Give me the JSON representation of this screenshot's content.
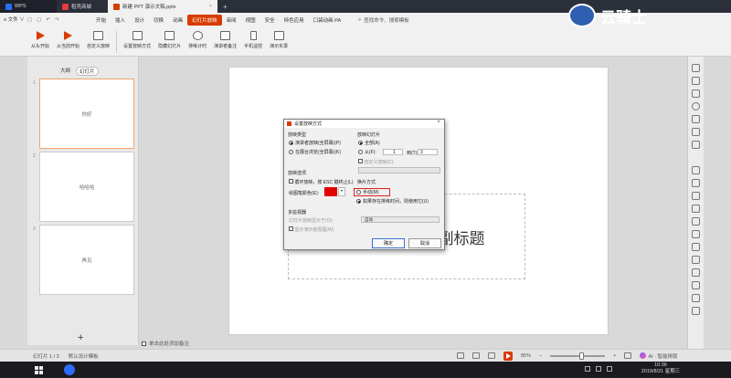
{
  "tabs": [
    {
      "label": "WPS"
    },
    {
      "label": "稻壳商城"
    },
    {
      "label": "新建 PPT 演示文稿.pptx"
    }
  ],
  "file_menu": "≡ 文件 ∨",
  "menus": [
    "开始",
    "插入",
    "设计",
    "切换",
    "动画",
    "幻灯片放映",
    "审阅",
    "视图",
    "安全",
    "特色应用",
    "口袋动画 PA"
  ],
  "search_placeholder": "查找命令、搜索模板",
  "ribbon": [
    "从头开始",
    "从当前开始",
    "自定义放映",
    "设置放映方式",
    "隐藏幻灯片",
    "排练计时",
    "演讲者备注",
    "手机遥控",
    "演示实录"
  ],
  "left_panel": {
    "view_tabs": [
      "大纲",
      "幻灯片"
    ],
    "thumbnails": [
      {
        "num": "1",
        "text": "你好"
      },
      {
        "num": "2",
        "text": "哈哈哈"
      },
      {
        "num": "3",
        "text": "再见"
      }
    ],
    "add": "+"
  },
  "slide": {
    "title": "副标题"
  },
  "note_bar": "单击此处添加备注",
  "status": {
    "slide_pos": "幻灯片 1 / 3",
    "template": "默认设计模板",
    "zoom": "85%",
    "ai": "AI · 智能排版"
  },
  "watermark": "云骑士",
  "clock": {
    "time": "10:36",
    "date": "2019/8/21 星期三"
  },
  "dialog": {
    "title": "设置放映方式",
    "close": "×",
    "show_type_label": "放映类型",
    "show_type_options": [
      "演讲者放映(全屏幕)(P)",
      "在展台浏览(全屏幕)(K)"
    ],
    "slides_label": "放映幻灯片",
    "slides_all": "全部(A)",
    "slides_from": "从(F):",
    "from_value": "1",
    "to_label": "到(T):",
    "to_value": "3",
    "custom_show": "自定义放映(C):",
    "options_label": "放映选项",
    "loop_option": "循环放映，按 ESC 键终止(L)",
    "pen_color": "绘图笔颜色(E):",
    "pen_color_value": "#e00000",
    "advance_label": "换片方式",
    "advance_manual": "手动(M)",
    "advance_timing": "如果存在排练时间，则使用它(U)",
    "multi_monitor_label": "多监视器",
    "monitor_select": "幻灯片放映显示于(O):",
    "monitor_value": "自动",
    "show_presenter": "显示演示者视图(W)",
    "ok": "确定",
    "cancel": "取消"
  }
}
